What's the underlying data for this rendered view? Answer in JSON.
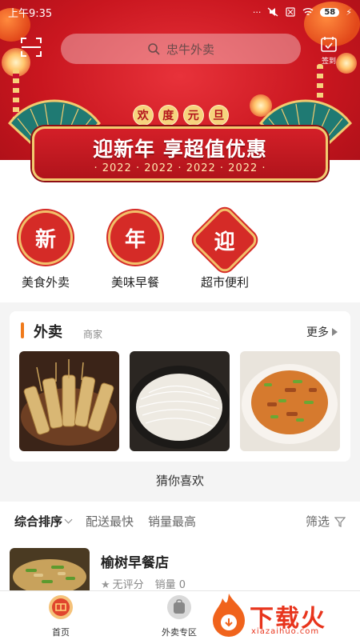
{
  "status": {
    "time": "上午9:35",
    "battery": "58"
  },
  "search": {
    "placeholder": "忠牛外卖"
  },
  "header": {
    "signin_label": "签到"
  },
  "banner": {
    "pill_chars": [
      "欢",
      "度",
      "元",
      "旦"
    ],
    "title": "迎新年 享超值优惠",
    "years": "· 2022 · 2022 · 2022 · 2022 ·"
  },
  "categories": [
    {
      "badge": "新",
      "label": "美食外卖"
    },
    {
      "badge": "年",
      "label": "美味早餐"
    },
    {
      "badge": "迎",
      "label": "超市便利"
    }
  ],
  "takeout": {
    "title": "外卖",
    "subtitle": "商家",
    "more": "更多"
  },
  "guess": "猜你喜欢",
  "sort": {
    "items": [
      "综合排序",
      "配送最快",
      "销量最高"
    ],
    "filter": "筛选"
  },
  "shop": {
    "name": "榆树早餐店",
    "rating": "无评分",
    "sales": "销量 0"
  },
  "tabs": [
    {
      "label": "首页"
    },
    {
      "label": "外卖专区"
    }
  ],
  "watermark": {
    "text": "下载火",
    "url": "xiazaihuo.com"
  },
  "colors": {
    "accent": "#f07a1b",
    "brand_red": "#d52b27"
  }
}
